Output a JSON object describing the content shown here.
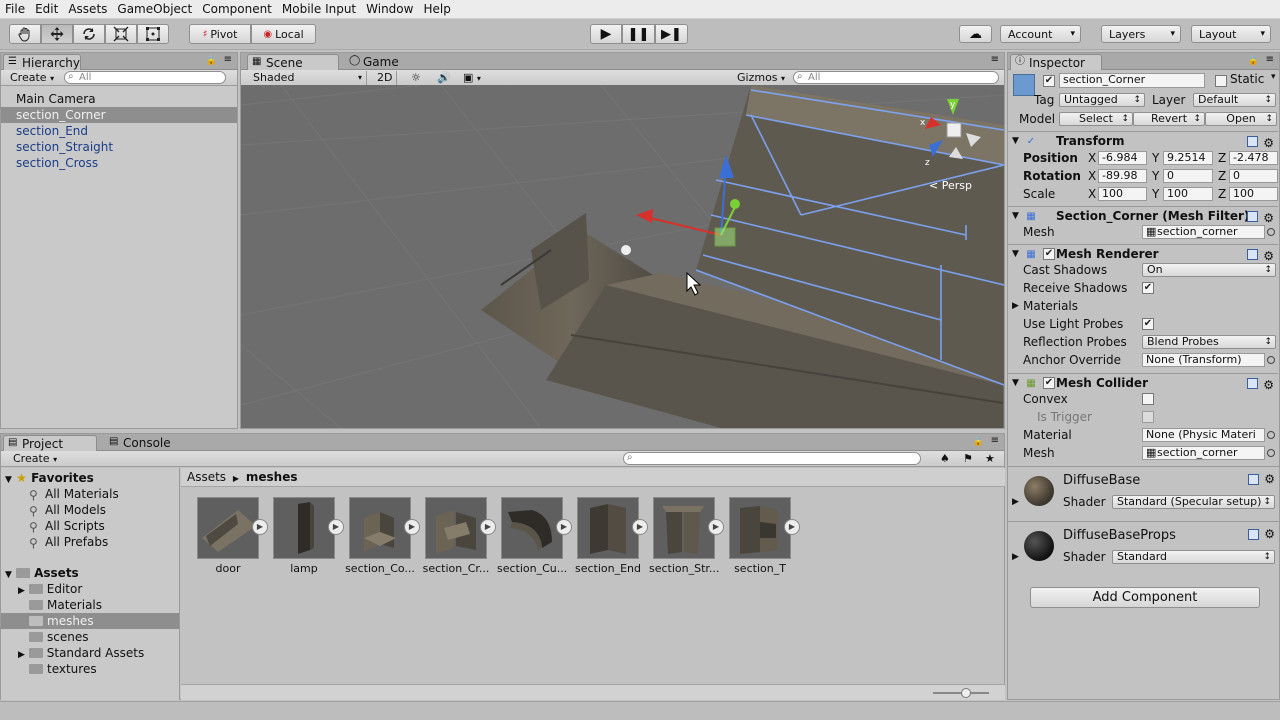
{
  "menu": [
    "File",
    "Edit",
    "Assets",
    "GameObject",
    "Component",
    "Mobile Input",
    "Window",
    "Help"
  ],
  "toolbar": {
    "pivot": "Pivot",
    "local": "Local",
    "account": "Account",
    "layers": "Layers",
    "layout": "Layout"
  },
  "hierarchy": {
    "tab": "Hierarchy",
    "create": "Create",
    "search_placeholder": "All",
    "items": [
      "Main Camera",
      "section_Corner",
      "section_End",
      "section_Straight",
      "section_Cross"
    ],
    "selected": "section_Corner"
  },
  "scene": {
    "tab_scene": "Scene",
    "tab_game": "Game",
    "shading": "Shaded",
    "mode2d": "2D",
    "gizmos": "Gizmos",
    "search_placeholder": "All",
    "persp": "Persp",
    "gizmo_axes": [
      "y",
      "x",
      "z"
    ]
  },
  "inspector": {
    "tab": "Inspector",
    "object_name": "section_Corner",
    "static_label": "Static",
    "tag_label": "Tag",
    "tag_value": "Untagged",
    "layer_label": "Layer",
    "layer_value": "Default",
    "model_label": "Model",
    "model_buttons": [
      "Select",
      "Revert",
      "Open"
    ],
    "transform": {
      "title": "Transform",
      "position_label": "Position",
      "position": {
        "x": "-6.984",
        "y": "9.2514",
        "z": "-2.478"
      },
      "rotation_label": "Rotation",
      "rotation": {
        "x": "-89.98",
        "y": "0",
        "z": "0"
      },
      "scale_label": "Scale",
      "scale": {
        "x": "100",
        "y": "100",
        "z": "100"
      }
    },
    "mesh_filter": {
      "title": "Section_Corner (Mesh Filter)",
      "mesh_label": "Mesh",
      "mesh_value": "section_corner"
    },
    "mesh_renderer": {
      "title": "Mesh Renderer",
      "cast_shadows_label": "Cast Shadows",
      "cast_shadows_value": "On",
      "receive_shadows_label": "Receive Shadows",
      "materials_label": "Materials",
      "light_probes_label": "Use Light Probes",
      "reflection_probes_label": "Reflection Probes",
      "reflection_probes_value": "Blend Probes",
      "anchor_override_label": "Anchor Override",
      "anchor_override_value": "None (Transform)"
    },
    "mesh_collider": {
      "title": "Mesh Collider",
      "convex_label": "Convex",
      "is_trigger_label": "Is Trigger",
      "material_label": "Material",
      "material_value": "None (Physic Materi",
      "mesh_label": "Mesh",
      "mesh_value": "section_corner"
    },
    "materials": [
      {
        "name": "DiffuseBase",
        "shader_label": "Shader",
        "shader": "Standard (Specular setup)"
      },
      {
        "name": "DiffuseBaseProps",
        "shader_label": "Shader",
        "shader": "Standard"
      }
    ],
    "add_component": "Add Component"
  },
  "project": {
    "tab": "Project",
    "console_tab": "Console",
    "create": "Create",
    "favorites_label": "Favorites",
    "favorites": [
      "All Materials",
      "All Models",
      "All Scripts",
      "All Prefabs"
    ],
    "assets_label": "Assets",
    "folders": [
      "Editor",
      "Materials",
      "meshes",
      "scenes",
      "Standard Assets",
      "textures"
    ],
    "selected_folder": "meshes",
    "breadcrumb": [
      "Assets",
      "meshes"
    ],
    "assets": [
      "door",
      "lamp",
      "section_Co...",
      "section_Cr...",
      "section_Cu...",
      "section_End",
      "section_Str...",
      "section_T"
    ]
  },
  "colors": {
    "selection": "#8e8e8e",
    "prefab_text": "#1a3d88",
    "scene_bg": "#6d6d6d",
    "gizmo_x": "#d8302a",
    "gizmo_y": "#7ad135",
    "gizmo_z": "#3b6fd8"
  }
}
